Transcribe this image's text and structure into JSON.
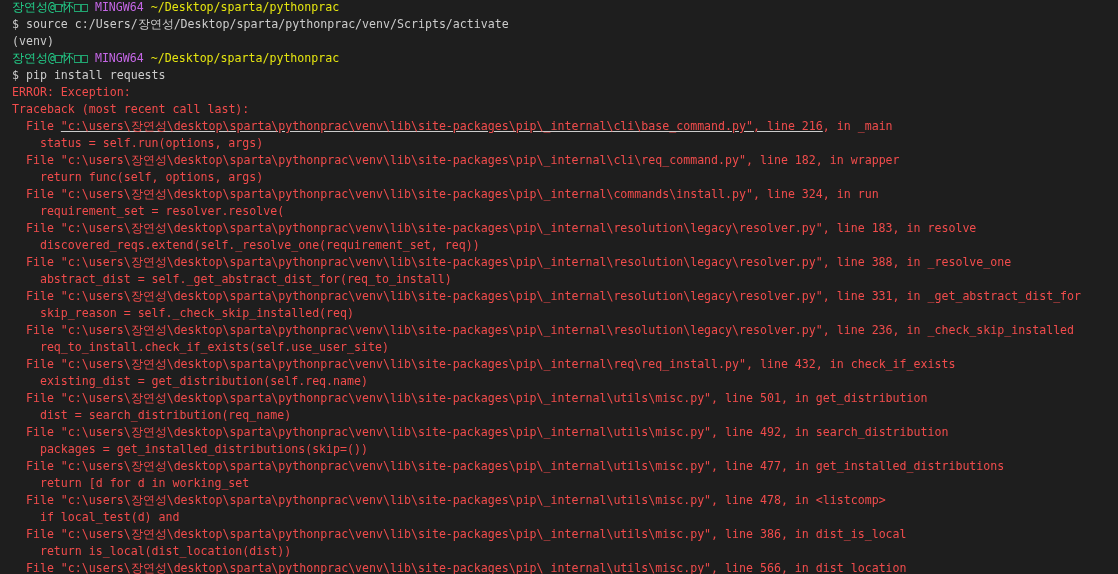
{
  "terminal": {
    "lines": [
      {
        "kind": "prompt",
        "user": "장연성@□怀□□",
        "system": "MINGW64",
        "path": "~/Desktop/sparta/pythonprac"
      },
      {
        "kind": "command",
        "text": "$ source c:/Users/장연성/Desktop/sparta/pythonprac/venv/Scripts/activate"
      },
      {
        "kind": "output",
        "text": "(venv)"
      },
      {
        "kind": "prompt",
        "user": "장연성@□怀□□",
        "system": "MINGW64",
        "path": "~/Desktop/sparta/pythonprac"
      },
      {
        "kind": "command",
        "text": "$ pip install requests"
      },
      {
        "kind": "error",
        "text": "ERROR: Exception:"
      },
      {
        "kind": "error",
        "text": "Traceback (most recent call last):"
      },
      {
        "kind": "frame",
        "prefix": "File ",
        "location": "\"c:\\users\\장연성\\desktop\\sparta\\pythonprac\\venv\\lib\\site-packages\\pip\\_internal\\cli\\base_command.py\", line 216",
        "suffix": ", in _main",
        "underlined": true
      },
      {
        "kind": "code",
        "text": "status = self.run(options, args)"
      },
      {
        "kind": "frame",
        "prefix": "File ",
        "location": "\"c:\\users\\장연성\\desktop\\sparta\\pythonprac\\venv\\lib\\site-packages\\pip\\_internal\\cli\\req_command.py\", line 182",
        "suffix": ", in wrapper",
        "underlined": false
      },
      {
        "kind": "code",
        "text": "return func(self, options, args)"
      },
      {
        "kind": "frame",
        "prefix": "File ",
        "location": "\"c:\\users\\장연성\\desktop\\sparta\\pythonprac\\venv\\lib\\site-packages\\pip\\_internal\\commands\\install.py\", line 324",
        "suffix": ", in run",
        "underlined": false
      },
      {
        "kind": "code",
        "text": "requirement_set = resolver.resolve("
      },
      {
        "kind": "frame",
        "prefix": "File ",
        "location": "\"c:\\users\\장연성\\desktop\\sparta\\pythonprac\\venv\\lib\\site-packages\\pip\\_internal\\resolution\\legacy\\resolver.py\", line 183",
        "suffix": ", in resolve",
        "underlined": false
      },
      {
        "kind": "code",
        "text": "discovered_reqs.extend(self._resolve_one(requirement_set, req))"
      },
      {
        "kind": "frame",
        "prefix": "File ",
        "location": "\"c:\\users\\장연성\\desktop\\sparta\\pythonprac\\venv\\lib\\site-packages\\pip\\_internal\\resolution\\legacy\\resolver.py\", line 388",
        "suffix": ", in _resolve_one",
        "underlined": false
      },
      {
        "kind": "code",
        "text": "abstract_dist = self._get_abstract_dist_for(req_to_install)"
      },
      {
        "kind": "frame",
        "prefix": "File ",
        "location": "\"c:\\users\\장연성\\desktop\\sparta\\pythonprac\\venv\\lib\\site-packages\\pip\\_internal\\resolution\\legacy\\resolver.py\", line 331",
        "suffix": ", in _get_abstract_dist_for",
        "underlined": false
      },
      {
        "kind": "code",
        "text": "skip_reason = self._check_skip_installed(req)"
      },
      {
        "kind": "frame",
        "prefix": "File ",
        "location": "\"c:\\users\\장연성\\desktop\\sparta\\pythonprac\\venv\\lib\\site-packages\\pip\\_internal\\resolution\\legacy\\resolver.py\", line 236",
        "suffix": ", in _check_skip_installed",
        "underlined": false
      },
      {
        "kind": "code",
        "text": "req_to_install.check_if_exists(self.use_user_site)"
      },
      {
        "kind": "frame",
        "prefix": "File ",
        "location": "\"c:\\users\\장연성\\desktop\\sparta\\pythonprac\\venv\\lib\\site-packages\\pip\\_internal\\req\\req_install.py\", line 432",
        "suffix": ", in check_if_exists",
        "underlined": false
      },
      {
        "kind": "code",
        "text": "existing_dist = get_distribution(self.req.name)"
      },
      {
        "kind": "frame",
        "prefix": "File ",
        "location": "\"c:\\users\\장연성\\desktop\\sparta\\pythonprac\\venv\\lib\\site-packages\\pip\\_internal\\utils\\misc.py\", line 501",
        "suffix": ", in get_distribution",
        "underlined": false
      },
      {
        "kind": "code",
        "text": "dist = search_distribution(req_name)"
      },
      {
        "kind": "frame",
        "prefix": "File ",
        "location": "\"c:\\users\\장연성\\desktop\\sparta\\pythonprac\\venv\\lib\\site-packages\\pip\\_internal\\utils\\misc.py\", line 492",
        "suffix": ", in search_distribution",
        "underlined": false
      },
      {
        "kind": "code",
        "text": "packages = get_installed_distributions(skip=())"
      },
      {
        "kind": "frame",
        "prefix": "File ",
        "location": "\"c:\\users\\장연성\\desktop\\sparta\\pythonprac\\venv\\lib\\site-packages\\pip\\_internal\\utils\\misc.py\", line 477",
        "suffix": ", in get_installed_distributions",
        "underlined": false
      },
      {
        "kind": "code",
        "text": "return [d for d in working_set"
      },
      {
        "kind": "frame",
        "prefix": "File ",
        "location": "\"c:\\users\\장연성\\desktop\\sparta\\pythonprac\\venv\\lib\\site-packages\\pip\\_internal\\utils\\misc.py\", line 478",
        "suffix": ", in <listcomp>",
        "underlined": false
      },
      {
        "kind": "code",
        "text": "if local_test(d) and"
      },
      {
        "kind": "frame",
        "prefix": "File ",
        "location": "\"c:\\users\\장연성\\desktop\\sparta\\pythonprac\\venv\\lib\\site-packages\\pip\\_internal\\utils\\misc.py\", line 386",
        "suffix": ", in dist_is_local",
        "underlined": false
      },
      {
        "kind": "code",
        "text": "return is_local(dist_location(dist))"
      },
      {
        "kind": "frame",
        "prefix": "File ",
        "location": "\"c:\\users\\장연성\\desktop\\sparta\\pythonprac\\venv\\lib\\site-packages\\pip\\_internal\\utils\\misc.py\", line 566",
        "suffix": ", in dist_location",
        "underlined": false
      }
    ]
  }
}
